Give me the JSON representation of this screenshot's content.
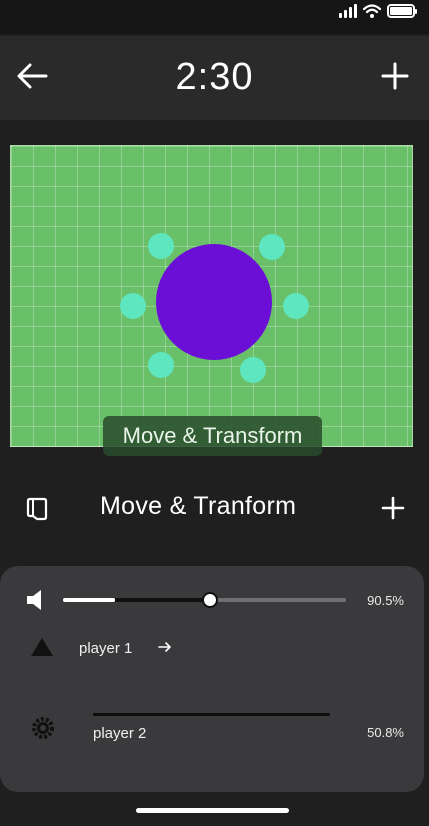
{
  "status_bar": {
    "icons": [
      "signal-icon",
      "wifi-icon",
      "battery-icon"
    ]
  },
  "header": {
    "back_icon": "arrow-left-icon",
    "timer": "2:30",
    "add_icon": "plus-icon"
  },
  "canvas": {
    "background_color": "#6abf69",
    "center_color": "#6b0fd6",
    "node_color": "#5ee6bf",
    "node_count": 6,
    "caption": "Move & Transform"
  },
  "toolbar": {
    "book_icon": "book-icon",
    "title": "Move & Tranform",
    "add_icon": "plus-icon"
  },
  "panel": {
    "volume": {
      "icon": "speaker-icon",
      "percent_label": "90.5%",
      "slider_fraction": 0.52
    },
    "player1": {
      "icon": "triangle-icon",
      "label": "player 1",
      "arrow_icon": "arrow-right-icon"
    },
    "player2": {
      "icon": "gear-icon",
      "label": "player 2",
      "percent_label": "50.8%"
    }
  }
}
